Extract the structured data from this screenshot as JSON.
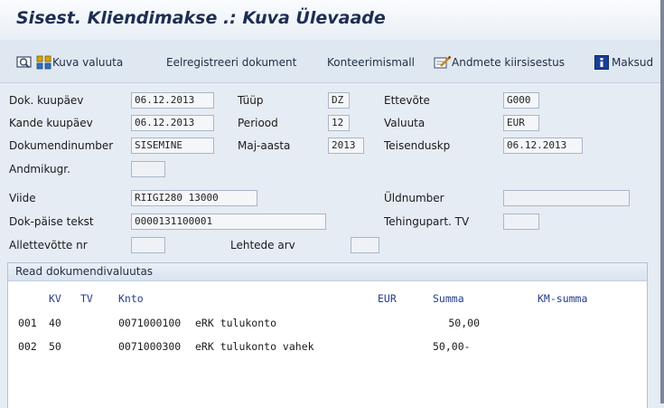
{
  "window": {
    "title": "Sisest. Kliendimakse .: Kuva Ülevaade"
  },
  "toolbar": {
    "kuva_valuuta": "Kuva valuuta",
    "eelregistreeri": "Eelregistreeri dokument",
    "konteerimismall": "Konteerimismall",
    "andmete_kiirsisestus": "Andmete kiirsisestus",
    "maksud": "Maksud"
  },
  "header": {
    "dok_kuupaev": {
      "label": "Dok. kuupäev",
      "value": "06.12.2013"
    },
    "tuup": {
      "label": "Tüüp",
      "value": "DZ"
    },
    "ettevote": {
      "label": "Ettevõte",
      "value": "G000"
    },
    "kande_kuupaev": {
      "label": "Kande kuupäev",
      "value": "06.12.2013"
    },
    "periood": {
      "label": "Periood",
      "value": "12"
    },
    "valuuta": {
      "label": "Valuuta",
      "value": "EUR"
    },
    "dokumendinumber": {
      "label": "Dokumendinumber",
      "value": "SISEMINE"
    },
    "maj_aasta": {
      "label": "Maj-aasta",
      "value": "2013"
    },
    "teisenduskp": {
      "label": "Teisenduskp",
      "value": "06.12.2013"
    },
    "andmikugr": {
      "label": "Andmikugr.",
      "value": ""
    },
    "viide": {
      "label": "Viide",
      "value": "RIIGI280  13000"
    },
    "uldnumber": {
      "label": "Üldnumber",
      "value": ""
    },
    "dok_paise_tekst": {
      "label": "Dok-päise tekst",
      "value": "0000131100001"
    },
    "tehingupart": {
      "label": "Tehingupart. TV",
      "value": ""
    },
    "allettevotte_nr": {
      "label": "Allettevõtte nr",
      "value": ""
    },
    "lehtede_arv": {
      "label": "Lehtede arv",
      "value": ""
    }
  },
  "items_group": {
    "title": "Read dokumendivaluutas",
    "columns": {
      "kv": "KV",
      "tv": "TV",
      "knto": "Knto",
      "currency": "EUR",
      "summa": "Summa",
      "km_summa": "KM-summa"
    },
    "rows": [
      {
        "nr": "001",
        "kv": "40",
        "knto": "0071000100",
        "text": "eRK tulukonto",
        "summa": "50,00"
      },
      {
        "nr": "002",
        "kv": "50",
        "knto": "0071000300",
        "text": "eRK tulukonto vahek",
        "summa": "50,00-"
      }
    ]
  },
  "colors": {
    "title": "#1c2e52",
    "toolbar_bg": "#dfe7f1",
    "column_header": "#243c90"
  }
}
